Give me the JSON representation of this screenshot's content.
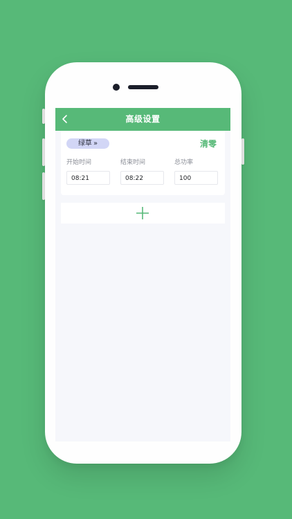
{
  "navbar": {
    "title": "高级设置",
    "back_icon": "chevron-left-icon"
  },
  "mode": {
    "label": "绿草",
    "chevron": "»"
  },
  "clear_label": "清零",
  "fields": [
    {
      "label": "开始时间",
      "value": "08:21"
    },
    {
      "label": "结束时间",
      "value": "08:22"
    },
    {
      "label": "总功率",
      "value": "100"
    }
  ],
  "add_icon": "plus-icon",
  "colors": {
    "brand_green": "#57b978",
    "pill_bg": "#d2d6f6",
    "screen_bg": "#f6f7fb"
  }
}
